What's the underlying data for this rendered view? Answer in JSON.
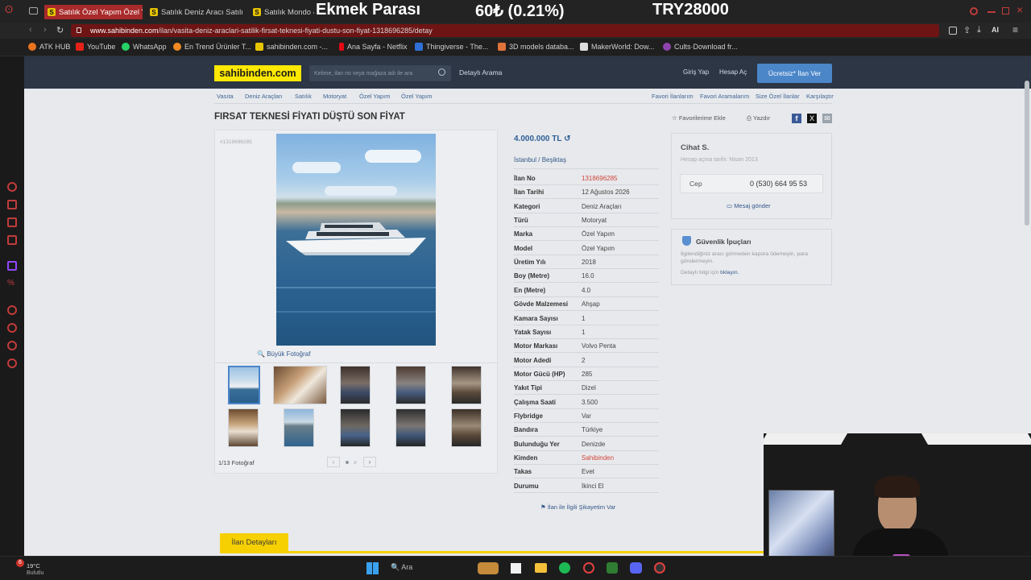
{
  "browser": {
    "tabs": [
      {
        "label": "Satılık Özel Yapım Özel Yap",
        "active": true
      },
      {
        "label": "Satılık Deniz Aracı Satılık",
        "active": false
      },
      {
        "label": "Satılık Mondo 4",
        "active": false
      }
    ],
    "url_host": "www.sahibinden.com",
    "url_path": "/ilan/vasita-deniz-araclari-satilik-firsat-teknesi-fiyati-dustu-son-fiyat-1318696285/detay",
    "ai_label": "AI"
  },
  "ticker": {
    "name": "Ekmek Parası",
    "change": "60₺ (0.21%)",
    "total": "TRY28000"
  },
  "bookmarks": [
    {
      "label": "ATK HUB",
      "color": "#e8731c"
    },
    {
      "label": "YouTube",
      "color": "#e62117"
    },
    {
      "label": "WhatsApp",
      "color": "#25d366"
    },
    {
      "label": "En Trend Ürünler T...",
      "color": "#f08a24"
    },
    {
      "label": "sahibinden.com -...",
      "color": "#e6c400"
    },
    {
      "label": "Ana Sayfa - Netflix",
      "color": "#e50914"
    },
    {
      "label": "Thingiverse - The...",
      "color": "#2f6fd6"
    },
    {
      "label": "3D models databa...",
      "color": "#e0733a"
    },
    {
      "label": "MakerWorld: Dow...",
      "color": "#dddddd"
    },
    {
      "label": "Cults·Download fr...",
      "color": "#8e44ad"
    }
  ],
  "site": {
    "logo": "sahibinden.com",
    "search_placeholder": "Kelime, ilan no veya mağaza adı ile ara",
    "detailed_search": "Detaylı Arama",
    "login": "Giriş Yap",
    "register": "Hesap Aç",
    "post_ad": "Ücretsiz* İlan Ver"
  },
  "breadcrumb": [
    "Vasıta",
    "Deniz Araçları",
    "Satılık",
    "Motoryat",
    "Özel Yapım",
    "Özel Yapım"
  ],
  "top_links": [
    "Favori İlanlarım",
    "Favori Aramalarım",
    "Size Özel İlanlar",
    "Karşılaştır"
  ],
  "listing": {
    "title": "FIRSAT TEKNESİ FİYATI DÜŞTÜ SON FİYAT",
    "id_tag": "#1318696285",
    "favorite": "Favorilerime Ekle",
    "print": "Yazdır",
    "price": "4.000.000 TL",
    "location_city": "İstanbul",
    "location_district": "Beşiktaş",
    "big_photo": "Büyük Fotoğraf",
    "photo_count": "1/13 Fotoğraf",
    "details_tab": "İlan Detayları",
    "report": "İlan ile İlgili Şikayetim Var",
    "specs": [
      {
        "label": "İlan No",
        "value": "1318696285",
        "red": true
      },
      {
        "label": "İlan Tarihi",
        "value": "12 Ağustos 2026"
      },
      {
        "label": "Kategori",
        "value": "Deniz Araçları"
      },
      {
        "label": "Türü",
        "value": "Motoryat"
      },
      {
        "label": "Marka",
        "value": "Özel Yapım"
      },
      {
        "label": "Model",
        "value": "Özel Yapım"
      },
      {
        "label": "Üretim Yılı",
        "value": "2018"
      },
      {
        "label": "Boy (Metre)",
        "value": "16.0"
      },
      {
        "label": "En (Metre)",
        "value": "4.0"
      },
      {
        "label": "Gövde Malzemesi",
        "value": "Ahşap"
      },
      {
        "label": "Kamara Sayısı",
        "value": "1"
      },
      {
        "label": "Yatak Sayısı",
        "value": "1"
      },
      {
        "label": "Motor Markası",
        "value": "Volvo Penta"
      },
      {
        "label": "Motor Adedi",
        "value": "2"
      },
      {
        "label": "Motor Gücü (HP)",
        "value": "285"
      },
      {
        "label": "Yakıt Tipi",
        "value": "Dizel"
      },
      {
        "label": "Çalışma Saati",
        "value": "3.500"
      },
      {
        "label": "Flybridge",
        "value": "Var"
      },
      {
        "label": "Bandıra",
        "value": "Türkiye"
      },
      {
        "label": "Bulunduğu Yer",
        "value": "Denizde"
      },
      {
        "label": "Kimden",
        "value": "Sahibinden",
        "red": true
      },
      {
        "label": "Takas",
        "value": "Evet"
      },
      {
        "label": "Durumu",
        "value": "İkinci El"
      }
    ]
  },
  "seller": {
    "name": "Cihat S.",
    "since": "Hesap açma tarihi: Nisan 2013",
    "phone_label": "Cep",
    "phone": "0 (530) 664 95 53",
    "message": "Mesaj gönder"
  },
  "security": {
    "title": "Güvenlik İpuçları",
    "text": "İlgilendiğiniz aracı görmeden kapora ödemeyin, para göndermeyin.",
    "more_prefix": "Detaylı bilgi için",
    "more_link": "tıklayın."
  },
  "taskbar": {
    "weather_temp": "19°C",
    "weather_desc": "Bulutlu",
    "badge": "6",
    "search": "Ara"
  },
  "colors": {
    "brand_yellow": "#ffe800",
    "header_dark": "#2c3645",
    "cta_blue": "#4b86c9",
    "accent_red": "#c23b3b"
  }
}
